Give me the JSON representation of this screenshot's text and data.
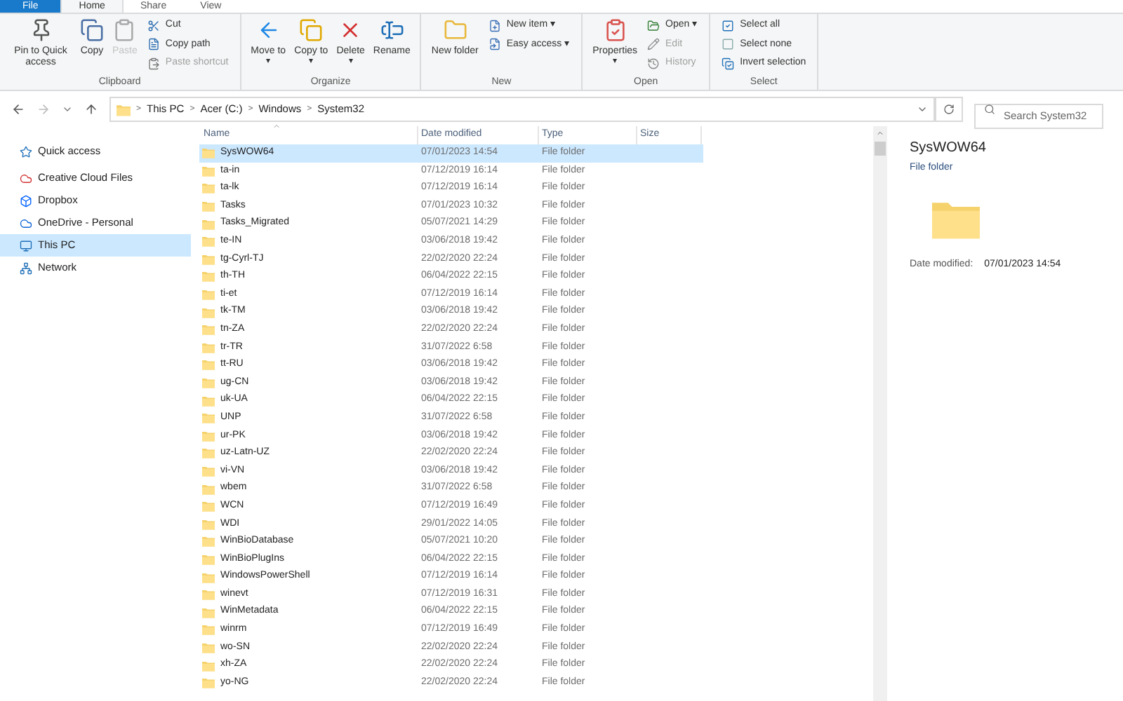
{
  "tabs": [
    {
      "label": "File",
      "selected": false,
      "kind": "file"
    },
    {
      "label": "Home",
      "selected": true,
      "kind": "tab"
    },
    {
      "label": "Share",
      "selected": false,
      "kind": "tab"
    },
    {
      "label": "View",
      "selected": false,
      "kind": "tab"
    }
  ],
  "ribbon": [
    {
      "label": "Clipboard",
      "commands": [
        {
          "kind": "large",
          "label": "Pin to Quick access",
          "disabled": false
        },
        {
          "kind": "large",
          "label": "Copy",
          "disabled": false
        },
        {
          "kind": "large",
          "label": "Paste",
          "disabled": true
        },
        {
          "kind": "stack",
          "items": [
            {
              "label": "Cut",
              "disabled": false
            },
            {
              "label": "Copy path",
              "disabled": false
            },
            {
              "label": "Paste shortcut",
              "disabled": true
            }
          ]
        }
      ]
    },
    {
      "label": "Organize",
      "commands": [
        {
          "kind": "large",
          "label": "Move to",
          "caret": "▾",
          "disabled": false
        },
        {
          "kind": "large",
          "label": "Copy to",
          "caret": "▾",
          "disabled": false
        },
        {
          "kind": "large",
          "label": "Delete",
          "caret": "▾",
          "disabled": false
        },
        {
          "kind": "large",
          "label": "Rename",
          "disabled": false
        }
      ]
    },
    {
      "label": "New",
      "commands": [
        {
          "kind": "large",
          "label": "New folder",
          "disabled": false
        },
        {
          "kind": "stack",
          "items": [
            {
              "label": "New item ▾",
              "disabled": false
            },
            {
              "label": "Easy access ▾",
              "disabled": false
            }
          ]
        }
      ]
    },
    {
      "label": "Open",
      "commands": [
        {
          "kind": "large",
          "label": "Properties",
          "caret": "▾",
          "disabled": false
        },
        {
          "kind": "stack",
          "items": [
            {
              "label": "Open ▾",
              "disabled": false
            },
            {
              "label": "Edit",
              "disabled": true
            },
            {
              "label": "History",
              "disabled": true
            }
          ]
        }
      ]
    },
    {
      "label": "Select",
      "commands": [
        {
          "kind": "stack",
          "items": [
            {
              "label": "Select all",
              "disabled": false
            },
            {
              "label": "Select none",
              "disabled": false
            },
            {
              "label": "Invert selection",
              "disabled": false
            }
          ]
        }
      ]
    }
  ],
  "address": {
    "path": [
      "This PC",
      "Acer (C:)",
      "Windows",
      "System32"
    ],
    "separator": ">"
  },
  "search": {
    "placeholder": "Search System32"
  },
  "sidebar": [
    {
      "label": "Quick access",
      "selected": false
    },
    {
      "label": "Creative Cloud Files",
      "selected": false
    },
    {
      "label": "Dropbox",
      "selected": false
    },
    {
      "label": "OneDrive - Personal",
      "selected": false
    },
    {
      "label": "This PC",
      "selected": true
    },
    {
      "label": "Network",
      "selected": false
    }
  ],
  "table": {
    "columns": [
      "Name",
      "Date modified",
      "Type",
      "Size"
    ],
    "rows": [
      {
        "name": "SysWOW64",
        "date": "07/01/2023 14:54",
        "type": "File folder",
        "selected": true
      },
      {
        "name": "ta-in",
        "date": "07/12/2019 16:14",
        "type": "File folder",
        "selected": false
      },
      {
        "name": "ta-lk",
        "date": "07/12/2019 16:14",
        "type": "File folder",
        "selected": false
      },
      {
        "name": "Tasks",
        "date": "07/01/2023 10:32",
        "type": "File folder",
        "selected": false
      },
      {
        "name": "Tasks_Migrated",
        "date": "05/07/2021 14:29",
        "type": "File folder",
        "selected": false
      },
      {
        "name": "te-IN",
        "date": "03/06/2018 19:42",
        "type": "File folder",
        "selected": false
      },
      {
        "name": "tg-Cyrl-TJ",
        "date": "22/02/2020 22:24",
        "type": "File folder",
        "selected": false
      },
      {
        "name": "th-TH",
        "date": "06/04/2022 22:15",
        "type": "File folder",
        "selected": false
      },
      {
        "name": "ti-et",
        "date": "07/12/2019 16:14",
        "type": "File folder",
        "selected": false
      },
      {
        "name": "tk-TM",
        "date": "03/06/2018 19:42",
        "type": "File folder",
        "selected": false
      },
      {
        "name": "tn-ZA",
        "date": "22/02/2020 22:24",
        "type": "File folder",
        "selected": false
      },
      {
        "name": "tr-TR",
        "date": "31/07/2022 6:58",
        "type": "File folder",
        "selected": false
      },
      {
        "name": "tt-RU",
        "date": "03/06/2018 19:42",
        "type": "File folder",
        "selected": false
      },
      {
        "name": "ug-CN",
        "date": "03/06/2018 19:42",
        "type": "File folder",
        "selected": false
      },
      {
        "name": "uk-UA",
        "date": "06/04/2022 22:15",
        "type": "File folder",
        "selected": false
      },
      {
        "name": "UNP",
        "date": "31/07/2022 6:58",
        "type": "File folder",
        "selected": false
      },
      {
        "name": "ur-PK",
        "date": "03/06/2018 19:42",
        "type": "File folder",
        "selected": false
      },
      {
        "name": "uz-Latn-UZ",
        "date": "22/02/2020 22:24",
        "type": "File folder",
        "selected": false
      },
      {
        "name": "vi-VN",
        "date": "03/06/2018 19:42",
        "type": "File folder",
        "selected": false
      },
      {
        "name": "wbem",
        "date": "31/07/2022 6:58",
        "type": "File folder",
        "selected": false
      },
      {
        "name": "WCN",
        "date": "07/12/2019 16:49",
        "type": "File folder",
        "selected": false
      },
      {
        "name": "WDI",
        "date": "29/01/2022 14:05",
        "type": "File folder",
        "selected": false
      },
      {
        "name": "WinBioDatabase",
        "date": "05/07/2021 10:20",
        "type": "File folder",
        "selected": false
      },
      {
        "name": "WinBioPlugIns",
        "date": "06/04/2022 22:15",
        "type": "File folder",
        "selected": false
      },
      {
        "name": "WindowsPowerShell",
        "date": "07/12/2019 16:14",
        "type": "File folder",
        "selected": false
      },
      {
        "name": "winevt",
        "date": "07/12/2019 16:31",
        "type": "File folder",
        "selected": false
      },
      {
        "name": "WinMetadata",
        "date": "06/04/2022 22:15",
        "type": "File folder",
        "selected": false
      },
      {
        "name": "winrm",
        "date": "07/12/2019 16:49",
        "type": "File folder",
        "selected": false
      },
      {
        "name": "wo-SN",
        "date": "22/02/2020 22:24",
        "type": "File folder",
        "selected": false
      },
      {
        "name": "xh-ZA",
        "date": "22/02/2020 22:24",
        "type": "File folder",
        "selected": false
      },
      {
        "name": "yo-NG",
        "date": "22/02/2020 22:24",
        "type": "File folder",
        "selected": false
      }
    ]
  },
  "details": {
    "title": "SysWOW64",
    "subtitle": "File folder",
    "label": "Date modified:",
    "value": "07/01/2023 14:54"
  }
}
